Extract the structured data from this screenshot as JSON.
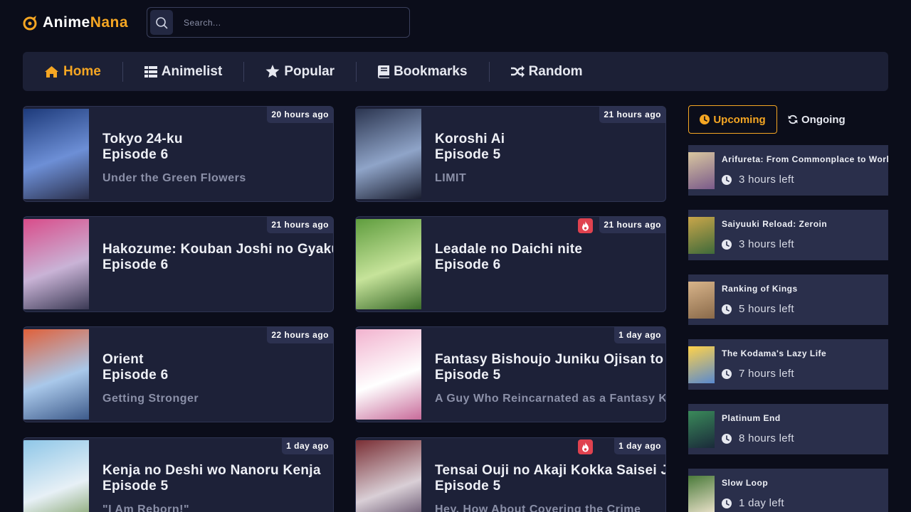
{
  "brand": {
    "part1": "Anime",
    "part2": "Nana"
  },
  "search": {
    "placeholder": "Search..."
  },
  "nav": [
    {
      "label": "Home",
      "icon": "home-icon",
      "active": true
    },
    {
      "label": "Animelist",
      "icon": "list-icon",
      "active": false
    },
    {
      "label": "Popular",
      "icon": "star-icon",
      "active": false
    },
    {
      "label": "Bookmarks",
      "icon": "book-icon",
      "active": false
    },
    {
      "label": "Random",
      "icon": "shuffle-icon",
      "active": false
    }
  ],
  "episodes": [
    {
      "title": "Tokyo 24-ku",
      "episode": "Episode 6",
      "subtitle": "Under the Green Flowers",
      "time": "20 hours ago",
      "hot": false
    },
    {
      "title": "Koroshi Ai",
      "episode": "Episode 5",
      "subtitle": "LIMIT",
      "time": "21 hours ago",
      "hot": false
    },
    {
      "title": "Hakozume: Kouban Joshi no Gyakushuu",
      "episode": "Episode 6",
      "subtitle": "",
      "time": "21 hours ago",
      "hot": false
    },
    {
      "title": "Leadale no Daichi nite",
      "episode": "Episode 6",
      "subtitle": "",
      "time": "21 hours ago",
      "hot": true
    },
    {
      "title": "Orient",
      "episode": "Episode 6",
      "subtitle": "Getting Stronger",
      "time": "22 hours ago",
      "hot": false
    },
    {
      "title": "Fantasy Bishoujo Juniku Ojisan to",
      "episode": "Episode 5",
      "subtitle": "A Guy Who Reincarnated as a Fantasy Knight",
      "time": "1 day ago",
      "hot": false
    },
    {
      "title": "Kenja no Deshi wo Nanoru Kenja",
      "episode": "Episode 5",
      "subtitle": "\"I Am Reborn!\"",
      "time": "1 day ago",
      "hot": false
    },
    {
      "title": "Tensai Ouji no Akaji Kokka Saisei Jutsu",
      "episode": "Episode 5",
      "subtitle": "Hey, How About Covering the Crime",
      "time": "1 day ago",
      "hot": true
    }
  ],
  "sidebar": {
    "tab_upcoming": "Upcoming",
    "tab_ongoing": "Ongoing",
    "items": [
      {
        "title": "Arifureta: From Commonplace to World's Strongest",
        "time_left": "3 hours left"
      },
      {
        "title": "Saiyuuki Reload: Zeroin",
        "time_left": "3 hours left"
      },
      {
        "title": "Ranking of Kings",
        "time_left": "5 hours left"
      },
      {
        "title": "The Kodama's Lazy Life",
        "time_left": "7 hours left"
      },
      {
        "title": "Platinum End",
        "time_left": "8 hours left"
      },
      {
        "title": "Slow Loop",
        "time_left": "1 day left"
      }
    ]
  },
  "colors": {
    "accent": "#f5a623",
    "background": "#0b0d1a",
    "card": "#1d2138",
    "hot": "#e0424f"
  }
}
